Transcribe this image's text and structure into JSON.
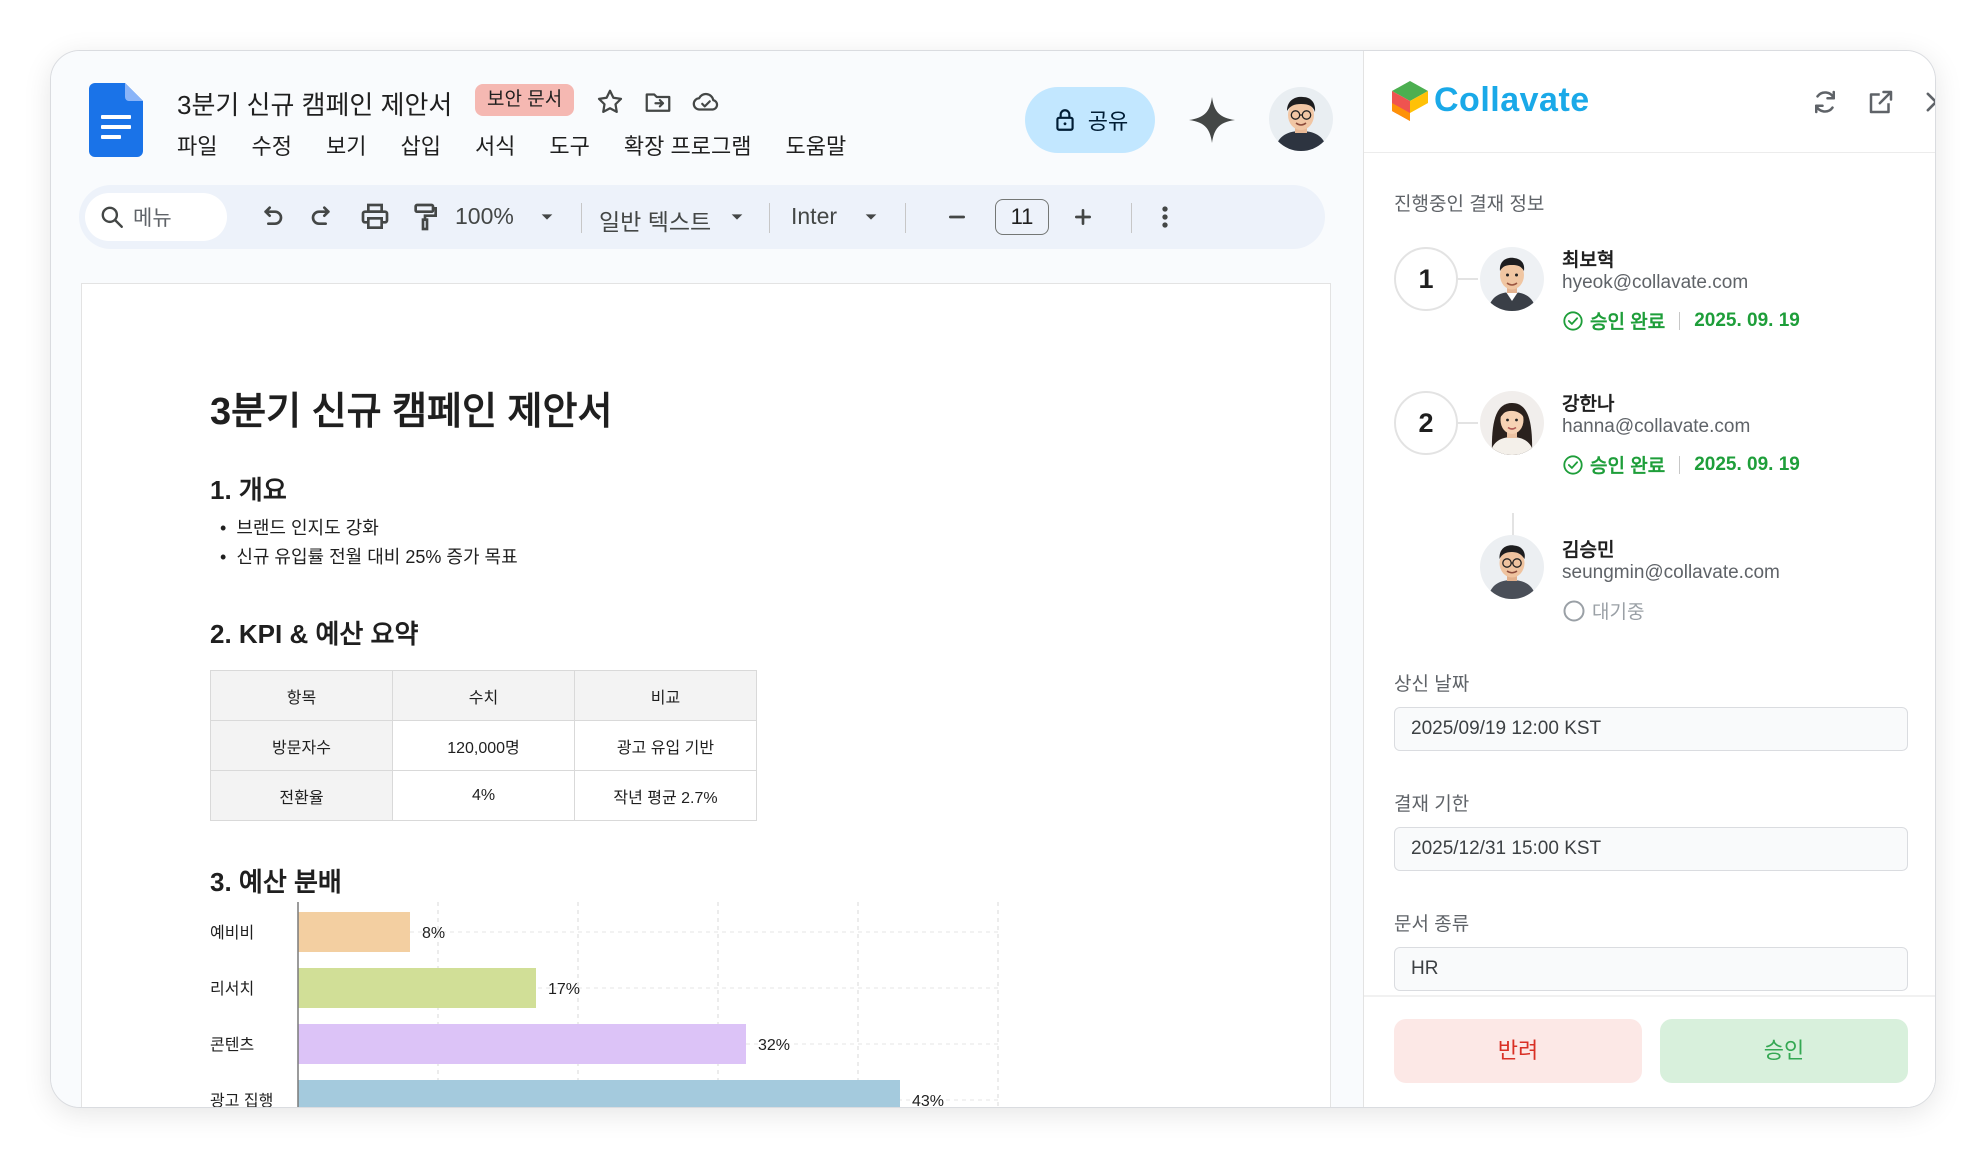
{
  "docs": {
    "title": "3분기 신규 캠페인 제안서",
    "badge": "보안 문서",
    "menu": [
      "파일",
      "수정",
      "보기",
      "삽입",
      "서식",
      "도구",
      "확장 프로그램",
      "도움말"
    ],
    "share_label": "공유",
    "toolbar": {
      "search_placeholder": "메뉴",
      "zoom": "100%",
      "style": "일반 텍스트",
      "font": "Inter",
      "font_size": "11"
    }
  },
  "document": {
    "heading": "3분기 신규 캠페인 제안서",
    "section1": "1. 개요",
    "bullets": [
      "브랜드 인지도 강화",
      "신규 유입률 전월 대비 25% 증가 목표"
    ],
    "section2": "2. KPI & 예산 요약",
    "table": {
      "headers": [
        "항목",
        "수치",
        "비교"
      ],
      "rows": [
        [
          "방문자수",
          "120,000명",
          "광고 유입 기반"
        ],
        [
          "전환율",
          "4%",
          "작년 평균 2.7%"
        ]
      ]
    },
    "section3": "3. 예산 분배"
  },
  "chart_data": {
    "type": "bar",
    "orientation": "horizontal",
    "categories": [
      "예비비",
      "리서치",
      "콘텐츠",
      "광고 집행"
    ],
    "values": [
      8,
      17,
      32,
      43
    ],
    "value_labels": [
      "8%",
      "17%",
      "32%",
      "43%"
    ],
    "colors": [
      "#f3cfa1",
      "#d1df97",
      "#dcc3f7",
      "#a4cadd"
    ],
    "xlim": [
      0,
      50
    ],
    "grid": true
  },
  "panel": {
    "brand": "Collavate",
    "section_label": "진행중인 결재 정보",
    "approvers": [
      {
        "step": "1",
        "name": "최보혁",
        "email": "hyeok@collavate.com",
        "status": "승인 완료",
        "date": "2025. 09. 19"
      },
      {
        "step": "2",
        "name": "강한나",
        "email": "hanna@collavate.com",
        "status": "승인 완료",
        "date": "2025. 09. 19"
      },
      {
        "step": "",
        "name": "김승민",
        "email": "seungmin@collavate.com",
        "status": "대기중",
        "date": ""
      }
    ],
    "submit_label": "상신 날짜",
    "submit_value": "2025/09/19 12:00 KST",
    "deadline_label": "결재 기한",
    "deadline_value": "2025/12/31 15:00 KST",
    "doctype_label": "문서 종류",
    "doctype_value": "HR",
    "reject_label": "반려",
    "approve_label": "승인"
  },
  "colors": {
    "accent": "#1aa9e8",
    "approved": "#1e9e3a",
    "reject": "#d93025",
    "share_bg": "#c2e7ff"
  }
}
